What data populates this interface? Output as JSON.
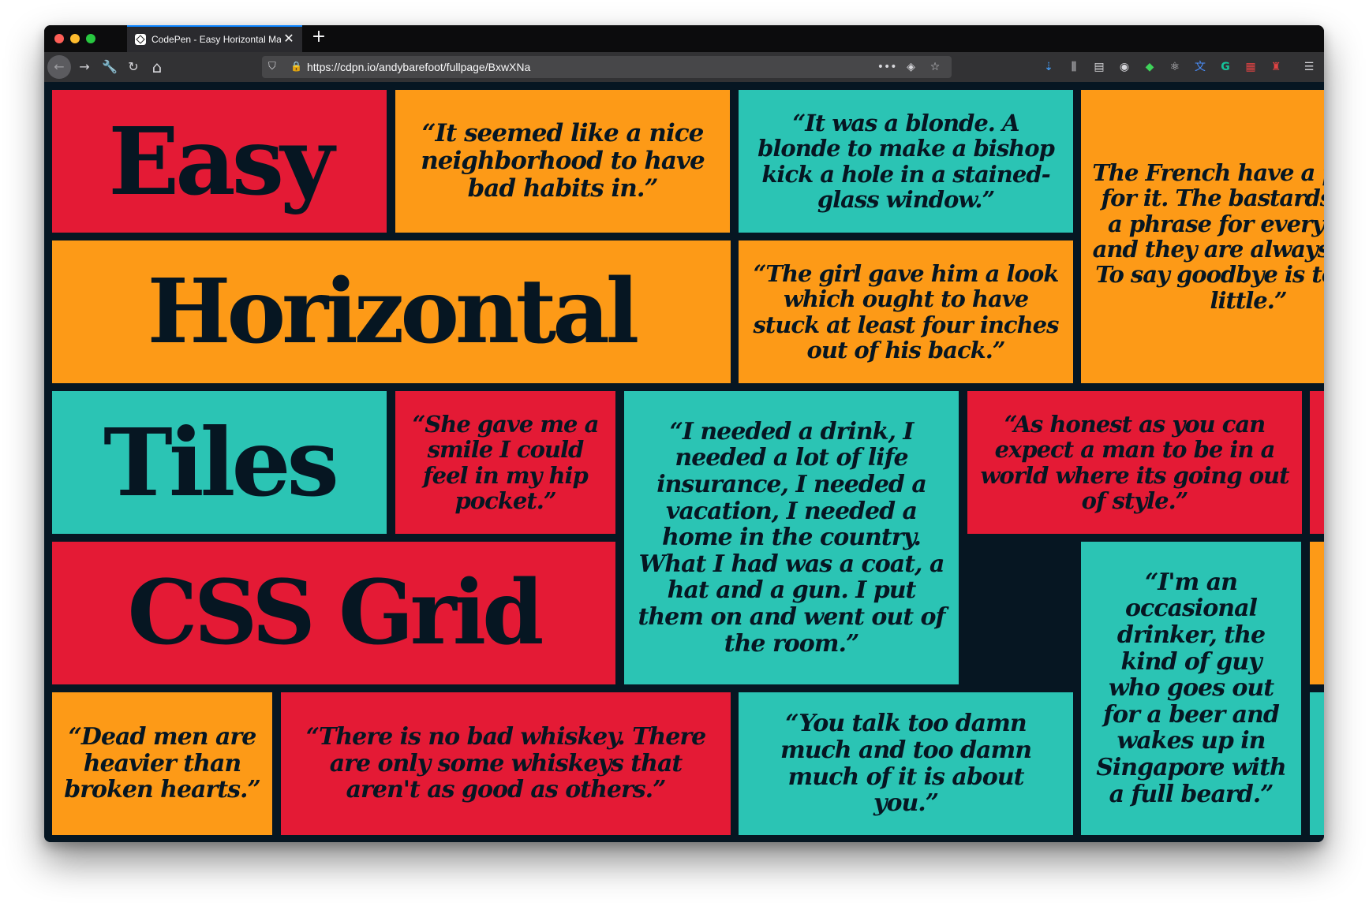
{
  "browser": {
    "tab_title": "CodePen - Easy Horizontal Masonry Tiles",
    "tab_close": "✕",
    "new_tab": "+",
    "url": "https://cdpn.io/andybarefoot/fullpage/BxwXNa",
    "nav": {
      "back": "←",
      "forward": "→",
      "tools": "🔧",
      "reload": "↻",
      "home": "⌂"
    },
    "url_icons": {
      "shield": "⛉",
      "lock": "🔒",
      "more": "•••",
      "pocket": "◈",
      "star": "☆"
    },
    "extensions": [
      "⇣",
      "⫼",
      "▤",
      "◉",
      "◆",
      "⚛",
      "文",
      "G",
      "▦",
      "♜",
      "☰"
    ],
    "colors": {
      "chrome": "#0c0c0d",
      "toolbar": "#323234",
      "accent": "#0a84ff"
    }
  },
  "page": {
    "colors": {
      "background": "#061622",
      "red": "#e41a35",
      "orange": "#fd9a17",
      "teal": "#2bc4b4",
      "text": "#061622"
    },
    "headings": {
      "easy": "Easy",
      "horizontal": "Horizontal",
      "tiles": "Tiles",
      "css_grid": "CSS Grid"
    },
    "quotes": {
      "neighborhood": "“It seemed like a nice neighborhood to have bad habits in.”",
      "blonde": "“It was a blonde. A blonde to make a bishop kick a hole in a stained-glass window.”",
      "french": "The French have a phrase for it. The bastards have a phrase for everything and they are always right. To say goodbye is to die a little.”",
      "girl": "“The girl gave him a look which ought to have stuck at least four inches out of his back.”",
      "smile": "“She gave me a smile I could feel in my hip pocket.”",
      "drink": "“I needed a drink, I needed a lot of life insurance, I needed a vacation, I needed a home in the country. What I had was a coat, a hat and a gun. I put them on and went out of the room.”",
      "honest": "“As honest as you can expect a man to be in a world where its going out of style.”",
      "drinker": "“I'm an occasional drinker, the kind of guy who goes out for a beer and wakes up in Singapore with a full beard.”",
      "dead_men": "“Dead men are heavier than broken hearts.”",
      "whiskey": "“There is no bad whiskey. There are only some whiskeys that aren't as good as others.”",
      "talk": "“You talk too damn much and too damn much of it is about you.”"
    }
  }
}
